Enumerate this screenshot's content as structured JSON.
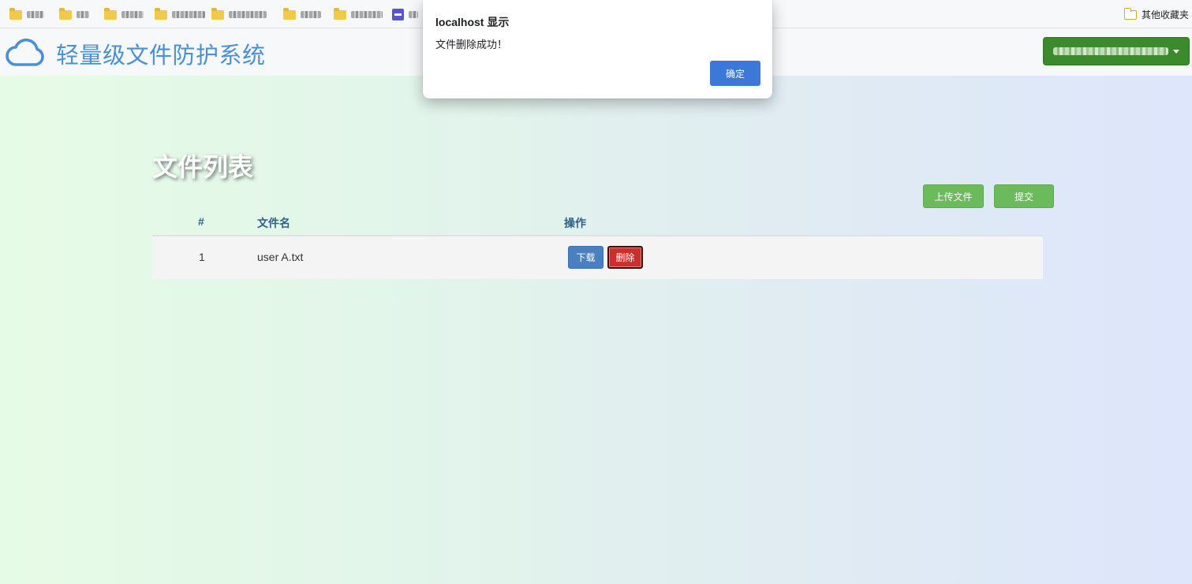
{
  "bookmarks": {
    "items": [
      {
        "icon": "folder-icon"
      },
      {
        "icon": "folder-icon"
      },
      {
        "icon": "folder-icon"
      },
      {
        "icon": "folder-icon"
      },
      {
        "icon": "folder-icon"
      },
      {
        "icon": "folder-icon"
      },
      {
        "icon": "folder-icon"
      },
      {
        "icon": "app-tile-icon"
      }
    ],
    "other_label": "其他收藏夹"
  },
  "header": {
    "app_title": "轻量级文件防护系统",
    "logo_icon": "cloud-icon",
    "user_menu": {
      "icon": "caret-down-icon"
    },
    "colors": {
      "title": "#4a90d9",
      "user_menu_bg": "#3b8b2c"
    }
  },
  "main": {
    "page_title": "文件列表",
    "upload_label": "上传文件",
    "submit_label": "提交",
    "table": {
      "headers": [
        "#",
        "文件名",
        "操作"
      ],
      "rows": [
        {
          "index": "1",
          "filename": "user A.txt",
          "download_label": "下载",
          "delete_label": "删除"
        }
      ]
    },
    "colors": {
      "action_green": "#6bbb5c",
      "download_blue": "#4a7fc0",
      "delete_red": "#c9302c"
    }
  },
  "dialog": {
    "title": "localhost 显示",
    "message": "文件删除成功！",
    "ok_label": "确定",
    "colors": {
      "ok_bg": "#3b78d8"
    }
  }
}
